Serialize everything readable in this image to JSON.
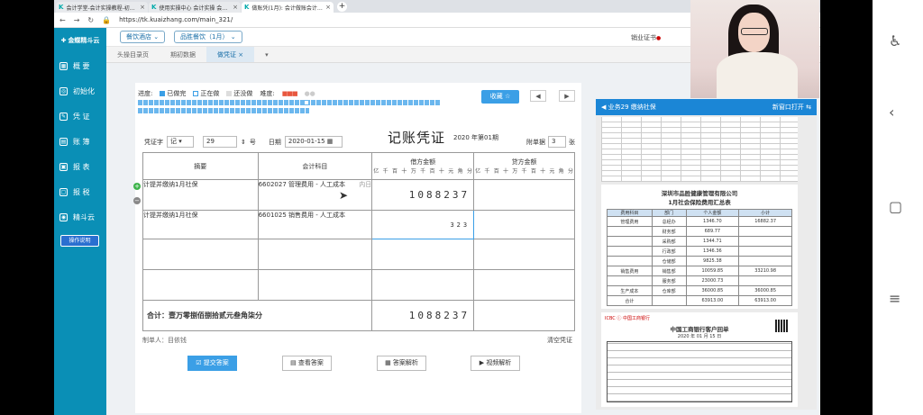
{
  "browser": {
    "tabs": [
      {
        "label": "会计学堂-会计实操教程-初级中级",
        "active": false
      },
      {
        "label": "使用实操中心 会计实操 会计培训",
        "active": false
      },
      {
        "label": "做账凭(1月): 会计做账会计做账",
        "active": true
      }
    ],
    "url": "https://tk.kuaizhang.com/main_321/"
  },
  "sidebar": {
    "logo": "金蝶精斗云",
    "items": [
      {
        "label": "概 要",
        "icon": "overview-icon"
      },
      {
        "label": "初始化",
        "icon": "init-icon"
      },
      {
        "label": "凭 证",
        "icon": "voucher-icon"
      },
      {
        "label": "账 簿",
        "icon": "ledger-icon"
      },
      {
        "label": "报 表",
        "icon": "report-icon"
      },
      {
        "label": "报 税",
        "icon": "tax-icon"
      },
      {
        "label": "精斗云",
        "icon": "cloud-icon"
      }
    ],
    "op_button": "操作说明"
  },
  "header": {
    "company_select": "餐饮酒店",
    "period_select": "品胜餐饮（1月）",
    "cert": "销业证书"
  },
  "tabs": [
    {
      "label": "头操目录页",
      "active": false
    },
    {
      "label": "期初数据",
      "active": false
    },
    {
      "label": "做凭证",
      "active": true
    }
  ],
  "progress": {
    "label_progress": "进度:",
    "done": "已做完",
    "doing": "正在做",
    "not_done": "还没做",
    "difficulty": "难度:",
    "done_fraction": 0.55
  },
  "favorite_button": "收藏 ☆",
  "voucher": {
    "title": "记账凭证",
    "period": "2020 年第01期",
    "word_label": "凭证字",
    "word_value": "记",
    "number": "29",
    "number_suffix": "号",
    "date_label": "日期",
    "date": "2020-01-15",
    "attach_label": "附单据",
    "attach_count": "3",
    "attach_suffix": "张",
    "col_summary": "摘要",
    "col_account": "会计科目",
    "col_debit": "借方金额",
    "col_credit": "贷方金额",
    "digit_labels": [
      "亿",
      "千",
      "百",
      "十",
      "万",
      "千",
      "百",
      "十",
      "元",
      "角",
      "分"
    ],
    "rows": [
      {
        "summary": "计提并缴纳1月社保",
        "account": "6602027 管理费用 - 人工成本",
        "debit": "1088237",
        "credit": "",
        "hint": "内日"
      },
      {
        "summary": "计提并缴纳1月社保",
        "account": "6601025 销售费用 - 人工成本",
        "debit": "323",
        "credit": "",
        "hint": ""
      },
      {
        "summary": "",
        "account": "",
        "debit": "",
        "credit": "",
        "hint": ""
      },
      {
        "summary": "",
        "account": "",
        "debit": "",
        "credit": "",
        "hint": ""
      }
    ],
    "total_label": "合计：壹万零捌佰捌拾贰元叁角柒分",
    "total_debit": "1088237",
    "preparer": "制单人：目依钱",
    "clear": "清空凭证"
  },
  "actions": [
    {
      "label": "提交答案",
      "icon": "submit-icon"
    },
    {
      "label": "查看答案",
      "icon": "view-icon"
    },
    {
      "label": "答案解析",
      "icon": "analysis-icon"
    },
    {
      "label": "视频解析",
      "icon": "video-icon"
    }
  ],
  "right_panel": {
    "title": "业务29 缴纳社保",
    "open_new": "新窗口打开",
    "doc2_title": "深圳市品胜健康管理有限公司",
    "doc2_subtitle": "1月社会保险费用汇总表",
    "doc2_headers": [
      "费用科目",
      "部门",
      "个人金额",
      "小计"
    ],
    "doc2_rows": [
      [
        "管理费用",
        "总经办",
        "1346.70",
        "16882.37"
      ],
      [
        "",
        "财务部",
        "689.77",
        ""
      ],
      [
        "",
        "采购部",
        "1344.71",
        ""
      ],
      [
        "",
        "行政部",
        "1346.36",
        ""
      ],
      [
        "",
        "仓储部",
        "9825.38",
        ""
      ],
      [
        "销售费用",
        "销售部",
        "10059.85",
        "33210.98"
      ],
      [
        "",
        "服务部",
        "23000.73",
        ""
      ],
      [
        "生产成本",
        "仓库部",
        "36000.85",
        "36000.85"
      ],
      [
        "合计",
        "",
        "63913.00",
        "63913.00"
      ]
    ],
    "doc3_bank": "中国工商银行",
    "doc3_title": "中国工商银行客户回单",
    "doc3_date": "2020 年 01 月 15 日"
  }
}
